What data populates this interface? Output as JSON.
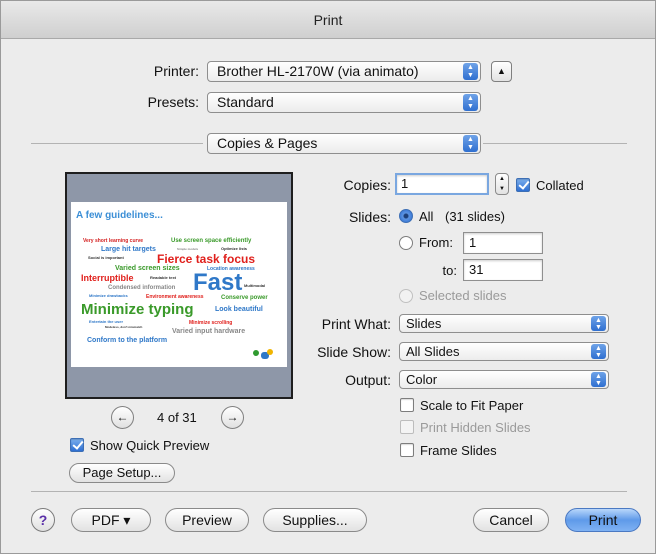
{
  "window": {
    "title": "Print"
  },
  "printer": {
    "label": "Printer:",
    "value": "Brother HL-2170W (via animato)"
  },
  "presets": {
    "label": "Presets:",
    "value": "Standard"
  },
  "section": {
    "value": "Copies & Pages"
  },
  "copies": {
    "label": "Copies:",
    "value": "1",
    "collated_label": "Collated",
    "collated": true
  },
  "slides": {
    "label": "Slides:",
    "all_label": "All",
    "all_count": "(31 slides)",
    "from_label": "From:",
    "from_value": "1",
    "to_label": "to:",
    "to_value": "31",
    "selected_label": "Selected slides"
  },
  "print_what": {
    "label": "Print What:",
    "value": "Slides"
  },
  "slide_show": {
    "label": "Slide Show:",
    "value": "All Slides"
  },
  "output": {
    "label": "Output:",
    "value": "Color"
  },
  "options": {
    "scale_to_fit": "Scale to Fit Paper",
    "print_hidden": "Print Hidden Slides",
    "frame_slides": "Frame Slides"
  },
  "preview": {
    "page_indicator": "4 of 31",
    "show_quick_preview": "Show Quick Preview",
    "slide": {
      "title": "A few guidelines...",
      "words": [
        "Very short learning curve",
        "Use screen space efficiently",
        "Large hit targets",
        "Simple models",
        "Optimize lists",
        "Social is important",
        "Fierce task focus",
        "Varied screen sizes",
        "Location awareness",
        "Interruptible",
        "Readable text",
        "Fast",
        "Multimodal",
        "Condensed information",
        "Minimize drawbacks",
        "Environment awareness",
        "Conserve power",
        "Minimize typing",
        "Look beautiful",
        "Entertain the user",
        "Minimize scrolling",
        "Modeless, don't mismatch",
        "Varied input hardware",
        "Conform to the platform"
      ]
    }
  },
  "buttons": {
    "help": "?",
    "page_setup": "Page Setup...",
    "pdf": "PDF ▾",
    "preview": "Preview",
    "supplies": "Supplies...",
    "cancel": "Cancel",
    "print": "Print"
  },
  "colors": {
    "accent": "#3574d4",
    "slide_blue": "#2f78c8",
    "slide_green": "#3a9a2a",
    "slide_red": "#e0201c"
  }
}
